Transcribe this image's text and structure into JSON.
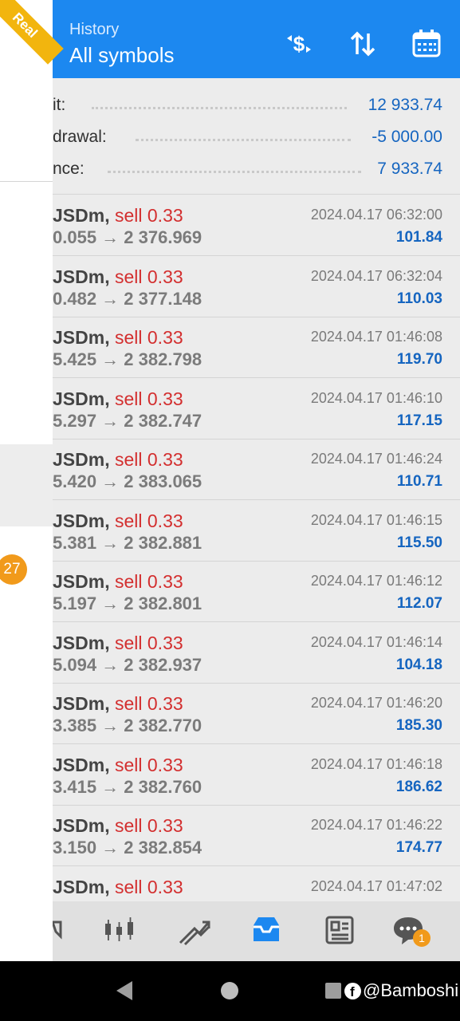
{
  "header": {
    "title": "History",
    "subtitle": "All symbols",
    "icons": [
      "currency-swap-icon",
      "sort-icon",
      "calendar-icon"
    ]
  },
  "summary": [
    {
      "label": "it:",
      "value": "12 933.74"
    },
    {
      "label": "drawal:",
      "value": "-5 000.00"
    },
    {
      "label": "nce:",
      "value": "7 933.74"
    }
  ],
  "trades": [
    {
      "symbol": "JSDm, ",
      "type": "sell 0.33",
      "prices": "0.055 → 2 376.969",
      "time": "2024.04.17 06:32:00",
      "profit": "101.84"
    },
    {
      "symbol": "JSDm, ",
      "type": "sell 0.33",
      "prices": "0.482 → 2 377.148",
      "time": "2024.04.17 06:32:04",
      "profit": "110.03"
    },
    {
      "symbol": "JSDm, ",
      "type": "sell 0.33",
      "prices": "5.425 → 2 382.798",
      "time": "2024.04.17 01:46:08",
      "profit": "119.70"
    },
    {
      "symbol": "JSDm, ",
      "type": "sell 0.33",
      "prices": "5.297 → 2 382.747",
      "time": "2024.04.17 01:46:10",
      "profit": "117.15"
    },
    {
      "symbol": "JSDm, ",
      "type": "sell 0.33",
      "prices": "5.420 → 2 383.065",
      "time": "2024.04.17 01:46:24",
      "profit": "110.71"
    },
    {
      "symbol": "JSDm, ",
      "type": "sell 0.33",
      "prices": "5.381 → 2 382.881",
      "time": "2024.04.17 01:46:15",
      "profit": "115.50"
    },
    {
      "symbol": "JSDm, ",
      "type": "sell 0.33",
      "prices": "5.197 → 2 382.801",
      "time": "2024.04.17 01:46:12",
      "profit": "112.07"
    },
    {
      "symbol": "JSDm, ",
      "type": "sell 0.33",
      "prices": "5.094 → 2 382.937",
      "time": "2024.04.17 01:46:14",
      "profit": "104.18"
    },
    {
      "symbol": "JSDm, ",
      "type": "sell 0.33",
      "prices": "3.385 → 2 382.770",
      "time": "2024.04.17 01:46:20",
      "profit": "185.30"
    },
    {
      "symbol": "JSDm, ",
      "type": "sell 0.33",
      "prices": "3.415 → 2 382.760",
      "time": "2024.04.17 01:46:18",
      "profit": "186.62"
    },
    {
      "symbol": "JSDm, ",
      "type": "sell 0.33",
      "prices": "3.150 → 2 382.854",
      "time": "2024.04.17 01:46:22",
      "profit": "174.77"
    },
    {
      "symbol": "JSDm, ",
      "type": "sell 0.33",
      "prices": "",
      "time": "2024.04.17 01:47:02",
      "profit": ""
    }
  ],
  "bottom_nav": {
    "items": [
      "quotes-icon",
      "candlestick-chart-icon",
      "trade-icon",
      "history-inbox-icon",
      "news-icon",
      "chat-icon"
    ],
    "active": "history-inbox-icon",
    "chat_badge": "1"
  },
  "drawer": {
    "account_banner": "Real",
    "badge": "27"
  },
  "watermark": "@Bamboshi",
  "colors": {
    "header": "#1c88f0",
    "accent_blue": "#1565c0",
    "sell_red": "#d32f2f",
    "badge_orange": "#f19a1b",
    "real_banner": "#f2b50e"
  }
}
